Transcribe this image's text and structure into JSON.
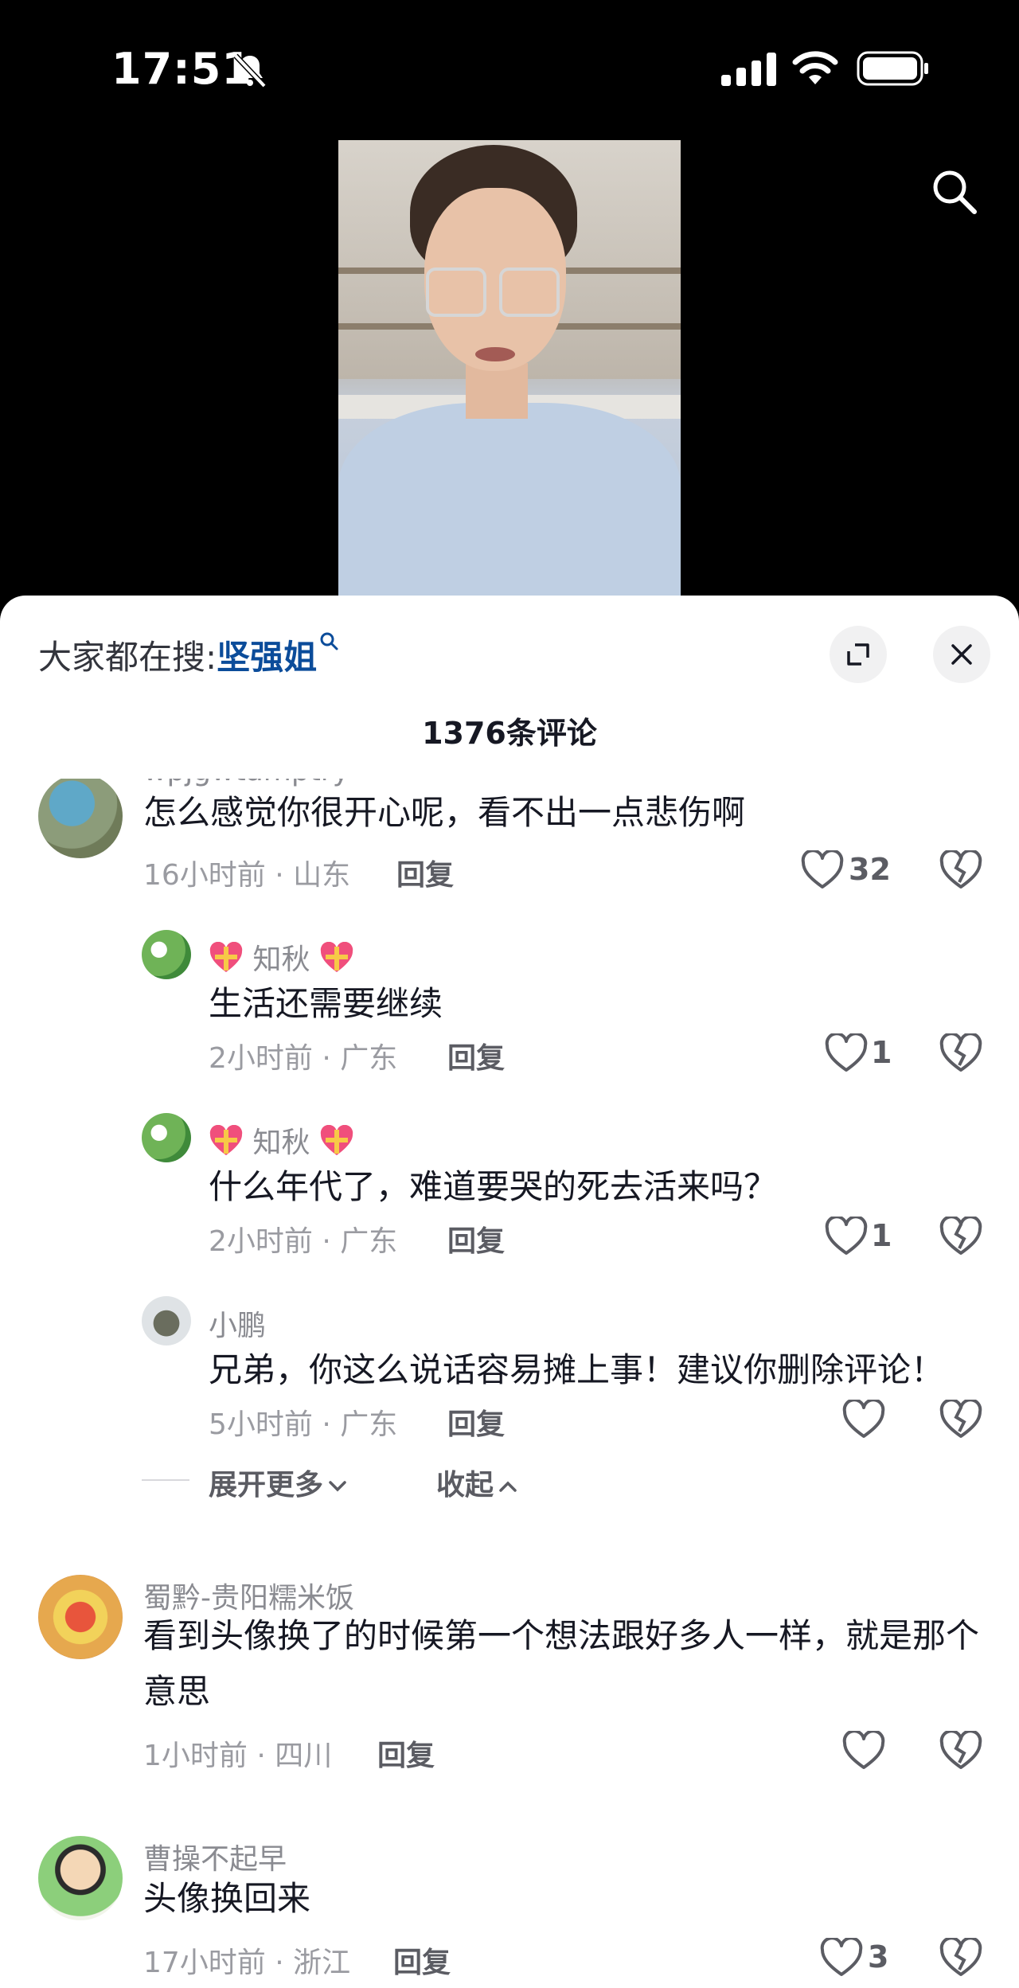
{
  "status_bar": {
    "time": "17:51"
  },
  "search": {
    "label": "大家都在搜:",
    "keyword": "坚强姐"
  },
  "comments_count": "1376条评论",
  "comments": [
    {
      "user": "wpjgwtamptry",
      "text": "怎么感觉你很开心呢，看不出一点悲伤啊",
      "time_loc": "16小时前 · 山东",
      "reply": "回复",
      "likes": "32"
    },
    {
      "user": "知秋",
      "text": "生活还需要继续",
      "time_loc": "2小时前 · 广东",
      "reply": "回复",
      "likes": "1"
    },
    {
      "user": "知秋",
      "text": "什么年代了，难道要哭的死去活来吗？",
      "time_loc": "2小时前 · 广东",
      "reply": "回复",
      "likes": "1"
    },
    {
      "user": "小鹏",
      "text": "兄弟，你这么说话容易摊上事！建议你删除评论！",
      "time_loc": "5小时前 · 广东",
      "reply": "回复",
      "likes": ""
    },
    {
      "user": "蜀黔-贵阳糯米饭",
      "text": "看到头像换了的时候第一个想法跟好多人一样，就是那个意思",
      "time_loc": "1小时前 · 四川",
      "reply": "回复",
      "likes": ""
    },
    {
      "user": "曹操不起早",
      "text": "头像换回来",
      "time_loc": "17小时前 · 浙江",
      "reply": "回复",
      "likes": "3"
    }
  ],
  "expand": {
    "more": "展开更多",
    "collapse": "收起"
  },
  "colors": {
    "keyword": "#0b4c9a",
    "sheet": "#ffffff",
    "background": "#000000"
  },
  "icons": [
    "bell-muted-icon",
    "signal-icon",
    "wifi-icon",
    "battery-icon",
    "search-icon",
    "expand-icon",
    "close-icon",
    "heart-icon",
    "broken-heart-icon",
    "heart-emoji-icon",
    "chevron-down-icon",
    "chevron-up-icon"
  ]
}
